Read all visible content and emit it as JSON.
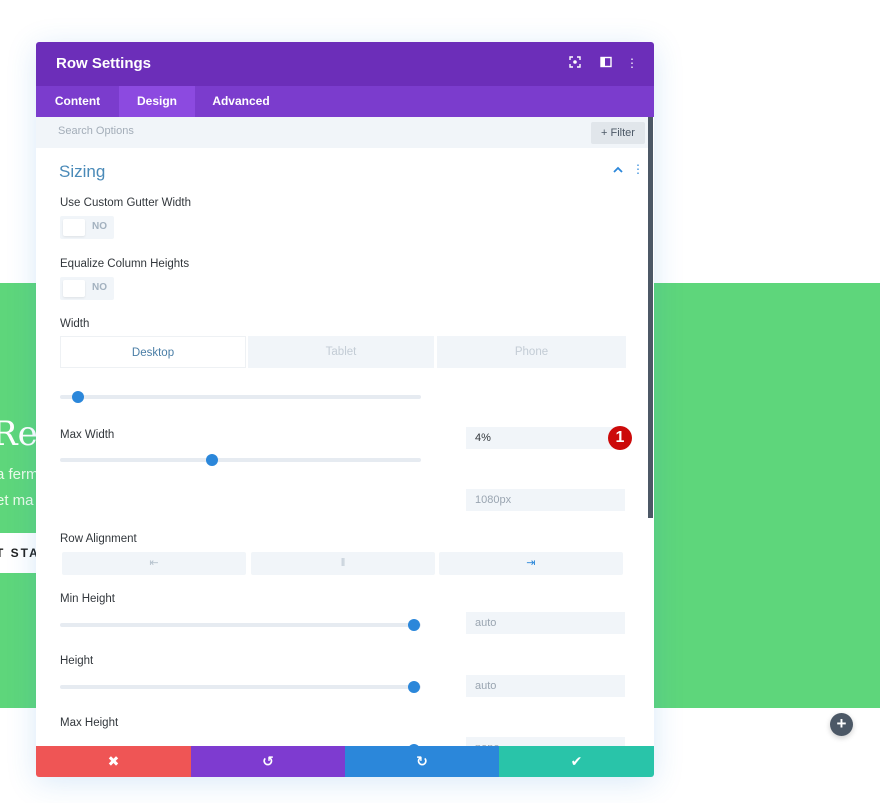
{
  "background": {
    "hero_title": "Rer",
    "hero_lines": [
      "a ferm",
      "et ma"
    ],
    "hero_button": "T STA",
    "add_icon": "+",
    "green": "#5ed67b"
  },
  "modal": {
    "title": "Row Settings",
    "header_icons": {
      "expand": "⦿",
      "split": "◫",
      "more": "⋮"
    },
    "tabs": [
      {
        "label": "Content",
        "active": false
      },
      {
        "label": "Design",
        "active": true
      },
      {
        "label": "Advanced",
        "active": false
      }
    ],
    "search": {
      "placeholder": "Search Options",
      "value": ""
    },
    "filter_label": "+ Filter",
    "section": {
      "title": "Sizing",
      "chevron": "⌃",
      "more": "⋮"
    },
    "fields": {
      "custom_gutter": {
        "label": "Use Custom Gutter Width",
        "value": "NO"
      },
      "equalize": {
        "label": "Equalize Column Heights",
        "value": "NO"
      },
      "width": {
        "label": "Width",
        "device_tabs": [
          "Desktop",
          "Tablet",
          "Phone"
        ],
        "active_device": "Desktop",
        "value": "4%",
        "slider_fraction": 0.05
      },
      "max_width": {
        "label": "Max Width",
        "value": "1080px",
        "slider_fraction": 0.42
      },
      "row_alignment": {
        "label": "Row Alignment",
        "options": [
          {
            "name": "left",
            "glyph": "⇤"
          },
          {
            "name": "center",
            "glyph": "‖"
          },
          {
            "name": "right",
            "glyph": "⇥"
          }
        ],
        "selected": "right"
      },
      "min_height": {
        "label": "Min Height",
        "value": "auto",
        "slider_fraction": 0.98
      },
      "height": {
        "label": "Height",
        "value": "auto",
        "slider_fraction": 0.98
      },
      "max_height": {
        "label": "Max Height",
        "value": "none",
        "slider_fraction": 0.98
      }
    },
    "annotation_badge": "1",
    "footer": {
      "cancel": {
        "glyph": "✖",
        "color": "#ef5555"
      },
      "undo": {
        "glyph": "↺",
        "color": "#7e3bd0"
      },
      "redo": {
        "glyph": "↻",
        "color": "#2b87da"
      },
      "save": {
        "glyph": "✔",
        "color": "#29c4a9"
      }
    },
    "colors": {
      "header": "#6c2eb9",
      "tabs": "#7b3ccd",
      "accent": "#2b87da"
    }
  }
}
